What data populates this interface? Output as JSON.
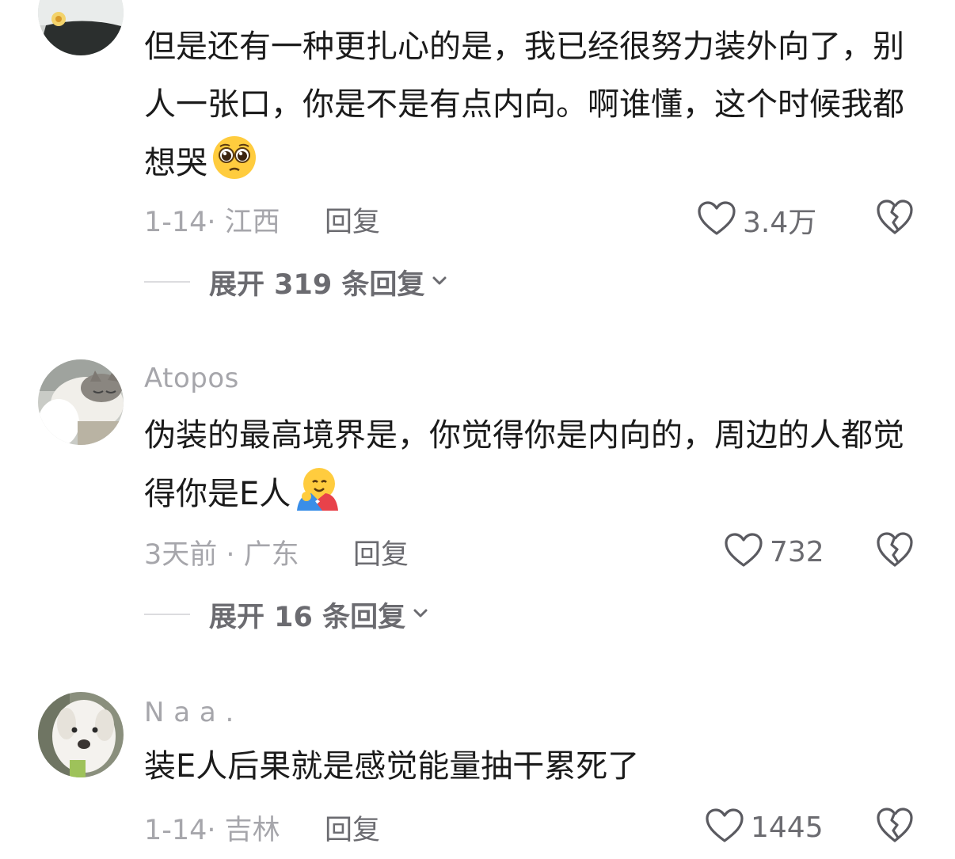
{
  "comments": [
    {
      "username": "",
      "text": "但是还有一种更扎心的是，我已经很努力装外向了，别人一张口，你是不是有点内向。啊谁懂，这个时候我都想哭",
      "emoji": "pleading-face",
      "date": "1-14· 江西",
      "reply_label": "回复",
      "likes": "3.4万",
      "expand_label": "展开 319 条回复"
    },
    {
      "username": "Atopos",
      "text": "伪装的最高境界是，你觉得你是内向的，周边的人都觉得你是E人",
      "emoji": "hugging-face",
      "date": "3天前 · 广东",
      "reply_label": "回复",
      "likes": "732",
      "expand_label": "展开 16 条回复"
    },
    {
      "username": "N a a .",
      "text": "装E人后果就是感觉能量抽干累死了",
      "date": "1-14· 吉林",
      "reply_label": "回复",
      "likes": "1445"
    }
  ],
  "icons": {
    "like": "heart-outline-icon",
    "dislike": "broken-heart-icon",
    "expand": "chevron-down-icon"
  },
  "colors": {
    "text": "#1b1b1b",
    "meta": "#a6a6ab",
    "secondary": "#6b6b70"
  }
}
